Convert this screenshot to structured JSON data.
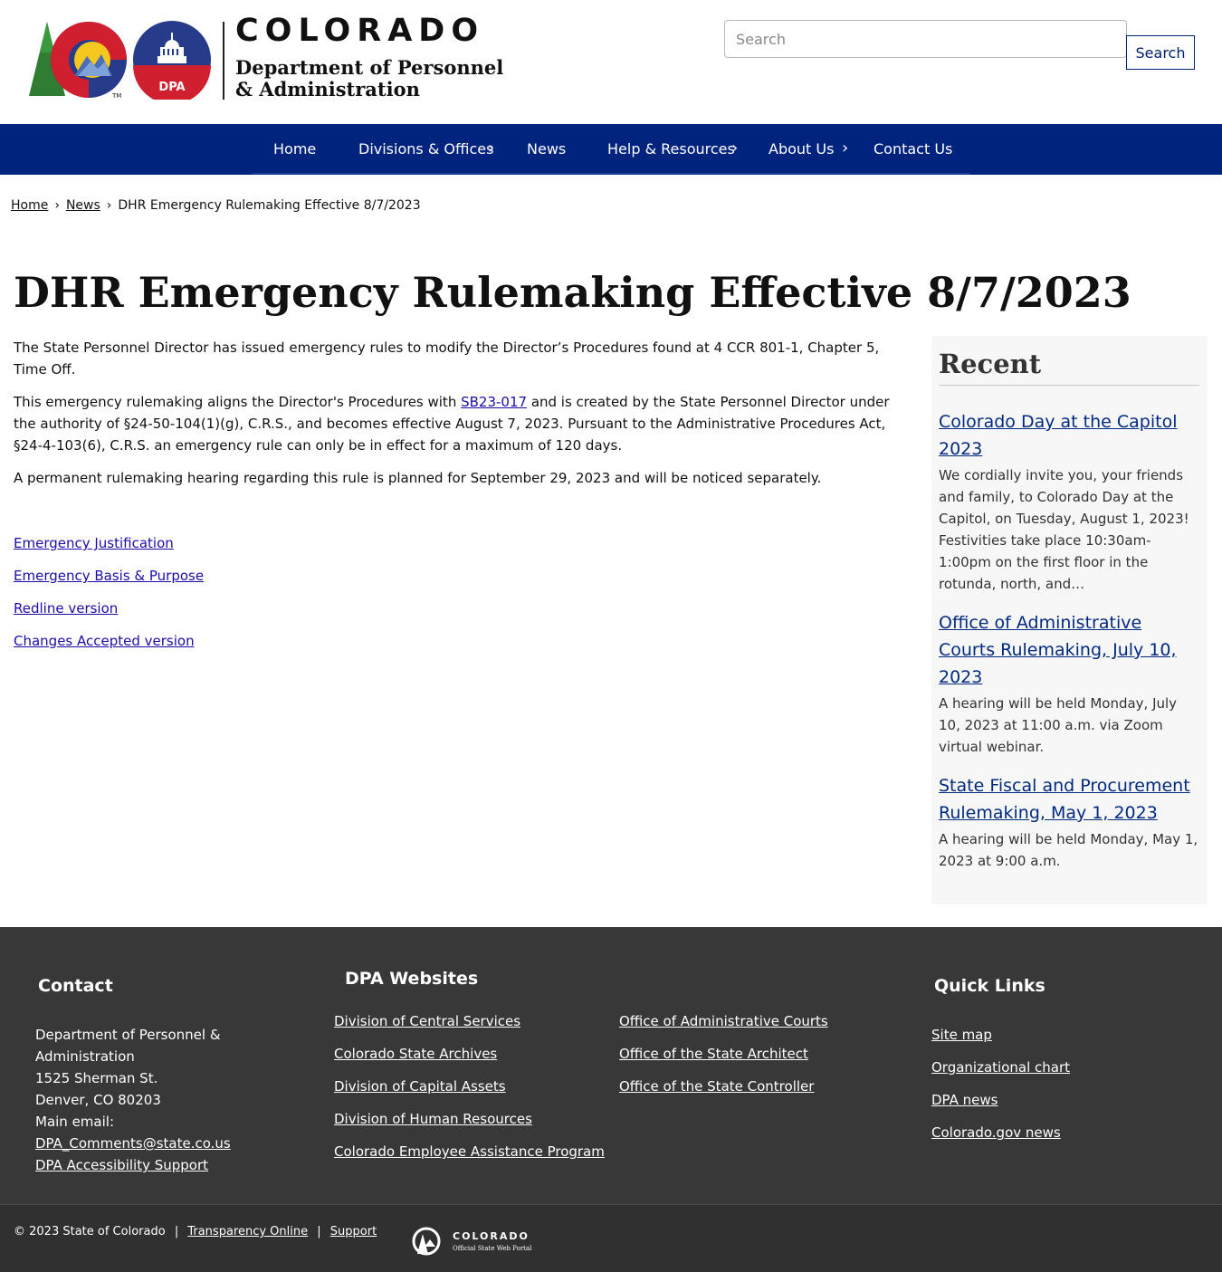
{
  "header": {
    "state_name": "COLORADO",
    "dept_line1": "Department of Personnel",
    "dept_line2": "& Administration",
    "dpa_badge": "DPA",
    "search_placeholder": "Search",
    "search_button": "Search"
  },
  "nav": {
    "items": [
      {
        "label": "Home"
      },
      {
        "label": "Divisions & Offices"
      },
      {
        "label": "News"
      },
      {
        "label": "Help & Resources"
      },
      {
        "label": "About Us"
      },
      {
        "label": "Contact Us"
      }
    ]
  },
  "breadcrumb": {
    "home": "Home",
    "news": "News",
    "current": "DHR Emergency Rulemaking Effective 8/7/2023"
  },
  "page": {
    "title": "DHR Emergency Rulemaking Effective 8/7/2023",
    "p1": "The State Personnel Director has issued emergency rules to modify the Director’s Procedures found at 4 CCR 801-1, Chapter 5, Time Off.",
    "p2_before": "This emergency rulemaking aligns the Director's Procedures with ",
    "p2_link": "SB23-017",
    "p2_after": " and is created by the State Personnel Director under the authority of §24-50-104(1)(g), C.R.S., and becomes effective August 7, 2023.  Pursuant to the Administrative Procedures Act, §24-4-103(6), C.R.S. an emergency rule can only be in effect for a maximum of 120 days.",
    "p3": "A permanent rulemaking hearing regarding this rule is planned for September 29, 2023 and will be noticed separately.",
    "links": [
      "Emergency Justification",
      "Emergency Basis & Purpose",
      "Redline version",
      "Changes Accepted version"
    ]
  },
  "sidebar": {
    "title": "Recent",
    "items": [
      {
        "title": "Colorado Day at the Capitol 2023",
        "summary": "We cordially invite you, your friends and family, to Colorado Day at the Capitol, on Tuesday, August 1, 2023!  Festivities take place 10:30am-1:00pm on the first floor in the rotunda, north, and…"
      },
      {
        "title": "Office of Administrative Courts Rulemaking, July 10, 2023",
        "summary": "A hearing will be held Monday, July 10, 2023 at 11:00 a.m. via Zoom virtual webinar."
      },
      {
        "title": "State Fiscal and Procurement Rulemaking, May 1, 2023",
        "summary": "A hearing will be held Monday, May 1, 2023 at 9:00 a.m."
      }
    ]
  },
  "footer": {
    "contact_heading": "Contact",
    "contact_org": "Department of Personnel & Administration",
    "contact_street": "1525 Sherman St.",
    "contact_city": "Denver, CO 80203",
    "contact_email_label": "Main email:",
    "contact_email": "DPA_Comments@state.co.us",
    "contact_accessibility": "DPA Accessibility Support",
    "websites_heading": "DPA Websites",
    "websites_col1": [
      "Division of Central Services",
      "Colorado State Archives",
      "Division of Capital Assets",
      "Division of Human Resources",
      "Colorado Employee Assistance Program"
    ],
    "websites_col2": [
      "Office of Administrative Courts",
      "Office of the State Architect",
      "Office of the State Controller"
    ],
    "quick_heading": "Quick Links",
    "quick_links": [
      "Site map",
      "Organizational chart",
      "DPA news",
      "Colorado.gov news"
    ],
    "copyright": "© 2023 State of Colorado",
    "sep": "|",
    "transparency": "Transparency Online",
    "support": "Support",
    "portal_name": "COLORADO",
    "portal_sub": "Official State Web Portal"
  },
  "colors": {
    "nav_bg": "#00237e",
    "co_red": "#d0202f",
    "co_blue": "#263b8a",
    "co_gold": "#f6c71e",
    "tree_green": "#2f7d32",
    "footer_bg": "#383838"
  }
}
